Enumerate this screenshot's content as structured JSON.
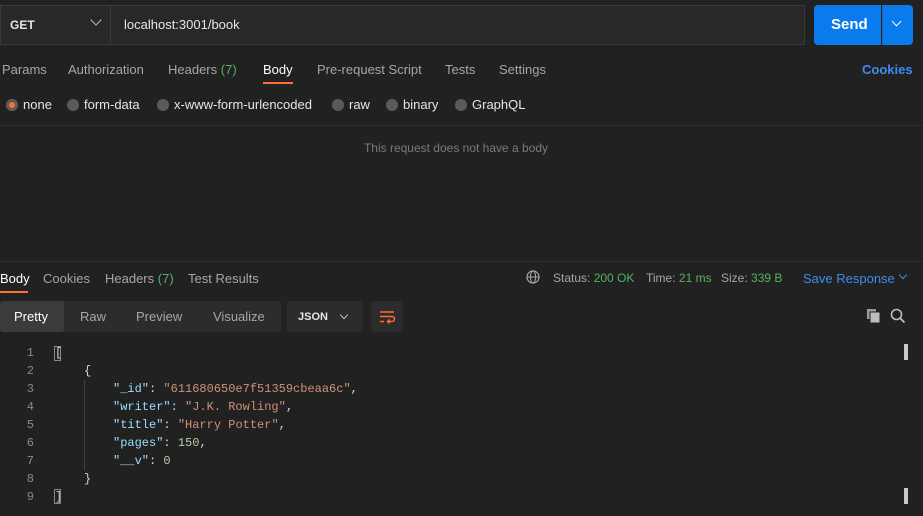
{
  "request": {
    "method": "GET",
    "url": "localhost:3001/book",
    "send_label": "Send",
    "tabs": [
      {
        "label": "Params"
      },
      {
        "label": "Authorization"
      },
      {
        "label": "Headers",
        "count": "(7)"
      },
      {
        "label": "Body",
        "active": true
      },
      {
        "label": "Pre-request Script"
      },
      {
        "label": "Tests"
      },
      {
        "label": "Settings"
      }
    ],
    "cookies_label": "Cookies",
    "body_types": [
      "none",
      "form-data",
      "x-www-form-urlencoded",
      "raw",
      "binary",
      "GraphQL"
    ],
    "selected_body_type": "none",
    "empty_message": "This request does not have a body"
  },
  "response": {
    "tabs": [
      {
        "label": "Body",
        "active": true
      },
      {
        "label": "Cookies"
      },
      {
        "label": "Headers",
        "count": "(7)"
      },
      {
        "label": "Test Results"
      }
    ],
    "status_label": "Status:",
    "status_value": "200 OK",
    "time_label": "Time:",
    "time_value": "21 ms",
    "size_label": "Size:",
    "size_value": "339 B",
    "save_label": "Save Response",
    "view_modes": [
      "Pretty",
      "Raw",
      "Preview",
      "Visualize"
    ],
    "format": "JSON",
    "line_numbers": [
      "1",
      "2",
      "3",
      "4",
      "5",
      "6",
      "7",
      "8",
      "9"
    ],
    "body_lines": [
      {
        "indent": 0,
        "text": "["
      },
      {
        "indent": 1,
        "text": "{"
      },
      {
        "indent": 2,
        "key": "\"_id\"",
        "sep": ": ",
        "val": "\"611680650e7f51359cbeaa6c\"",
        "vtype": "str",
        "tail": ","
      },
      {
        "indent": 2,
        "key": "\"writer\"",
        "sep": ": ",
        "val": "\"J.K. Rowling\"",
        "vtype": "str",
        "tail": ","
      },
      {
        "indent": 2,
        "key": "\"title\"",
        "sep": ": ",
        "val": "\"Harry Potter\"",
        "vtype": "str",
        "tail": ","
      },
      {
        "indent": 2,
        "key": "\"pages\"",
        "sep": ": ",
        "val": "150",
        "vtype": "num",
        "tail": ","
      },
      {
        "indent": 2,
        "key": "\"__v\"",
        "sep": ": ",
        "val": "0",
        "vtype": "num",
        "tail": ""
      },
      {
        "indent": 1,
        "text": "}"
      },
      {
        "indent": 0,
        "text": "]"
      }
    ]
  },
  "colors": {
    "accent": "#ff6c37",
    "send": "#097bed",
    "success": "#53b364",
    "link": "#3f8cf0"
  }
}
